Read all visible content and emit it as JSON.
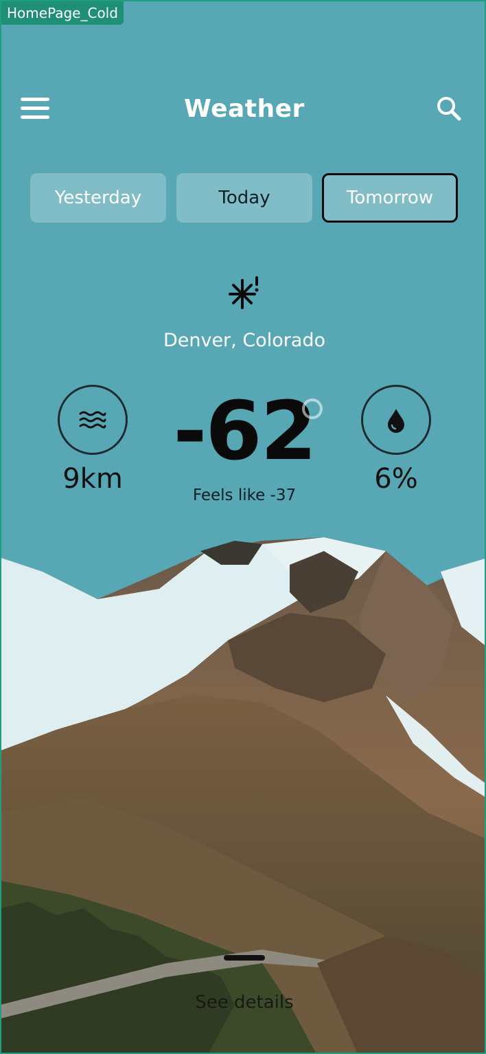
{
  "frame": {
    "tag": "HomePage_Cold"
  },
  "header": {
    "title": "Weather"
  },
  "tabs": [
    {
      "label": "Yesterday"
    },
    {
      "label": "Today"
    },
    {
      "label": "Tomorrow"
    }
  ],
  "current": {
    "location": "Denver, Colorado",
    "temperature": "-62",
    "feels_like": "Feels like -37",
    "wind": "9km",
    "humidity": "6%",
    "condition_icon": "snowflake-alert-icon"
  },
  "footer": {
    "details_label": "See details"
  },
  "colors": {
    "background": "#57a7b5",
    "frame_border": "#1f9e82",
    "selected_tab_border": "#0a0a0a"
  }
}
